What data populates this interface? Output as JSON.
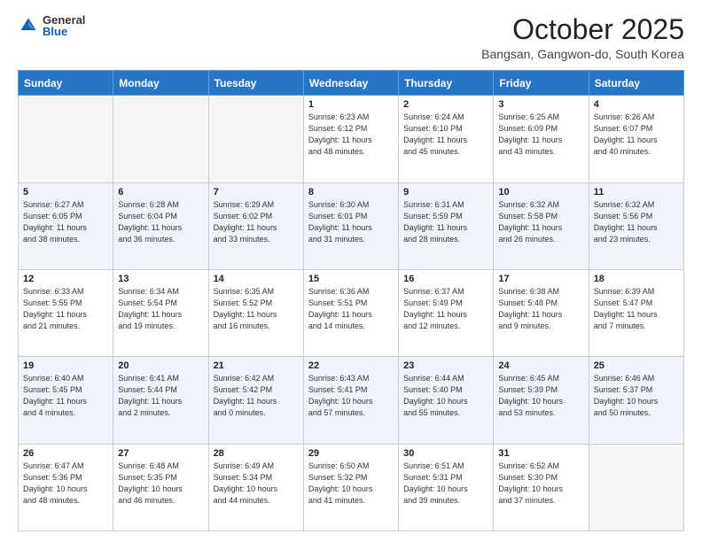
{
  "header": {
    "logo_general": "General",
    "logo_blue": "Blue",
    "month_title": "October 2025",
    "location": "Bangsan, Gangwon-do, South Korea"
  },
  "days_of_week": [
    "Sunday",
    "Monday",
    "Tuesday",
    "Wednesday",
    "Thursday",
    "Friday",
    "Saturday"
  ],
  "weeks": [
    [
      {
        "num": "",
        "info": ""
      },
      {
        "num": "",
        "info": ""
      },
      {
        "num": "",
        "info": ""
      },
      {
        "num": "1",
        "info": "Sunrise: 6:23 AM\nSunset: 6:12 PM\nDaylight: 11 hours\nand 48 minutes."
      },
      {
        "num": "2",
        "info": "Sunrise: 6:24 AM\nSunset: 6:10 PM\nDaylight: 11 hours\nand 45 minutes."
      },
      {
        "num": "3",
        "info": "Sunrise: 6:25 AM\nSunset: 6:09 PM\nDaylight: 11 hours\nand 43 minutes."
      },
      {
        "num": "4",
        "info": "Sunrise: 6:26 AM\nSunset: 6:07 PM\nDaylight: 11 hours\nand 40 minutes."
      }
    ],
    [
      {
        "num": "5",
        "info": "Sunrise: 6:27 AM\nSunset: 6:05 PM\nDaylight: 11 hours\nand 38 minutes."
      },
      {
        "num": "6",
        "info": "Sunrise: 6:28 AM\nSunset: 6:04 PM\nDaylight: 11 hours\nand 36 minutes."
      },
      {
        "num": "7",
        "info": "Sunrise: 6:29 AM\nSunset: 6:02 PM\nDaylight: 11 hours\nand 33 minutes."
      },
      {
        "num": "8",
        "info": "Sunrise: 6:30 AM\nSunset: 6:01 PM\nDaylight: 11 hours\nand 31 minutes."
      },
      {
        "num": "9",
        "info": "Sunrise: 6:31 AM\nSunset: 5:59 PM\nDaylight: 11 hours\nand 28 minutes."
      },
      {
        "num": "10",
        "info": "Sunrise: 6:32 AM\nSunset: 5:58 PM\nDaylight: 11 hours\nand 26 minutes."
      },
      {
        "num": "11",
        "info": "Sunrise: 6:32 AM\nSunset: 5:56 PM\nDaylight: 11 hours\nand 23 minutes."
      }
    ],
    [
      {
        "num": "12",
        "info": "Sunrise: 6:33 AM\nSunset: 5:55 PM\nDaylight: 11 hours\nand 21 minutes."
      },
      {
        "num": "13",
        "info": "Sunrise: 6:34 AM\nSunset: 5:54 PM\nDaylight: 11 hours\nand 19 minutes."
      },
      {
        "num": "14",
        "info": "Sunrise: 6:35 AM\nSunset: 5:52 PM\nDaylight: 11 hours\nand 16 minutes."
      },
      {
        "num": "15",
        "info": "Sunrise: 6:36 AM\nSunset: 5:51 PM\nDaylight: 11 hours\nand 14 minutes."
      },
      {
        "num": "16",
        "info": "Sunrise: 6:37 AM\nSunset: 5:49 PM\nDaylight: 11 hours\nand 12 minutes."
      },
      {
        "num": "17",
        "info": "Sunrise: 6:38 AM\nSunset: 5:48 PM\nDaylight: 11 hours\nand 9 minutes."
      },
      {
        "num": "18",
        "info": "Sunrise: 6:39 AM\nSunset: 5:47 PM\nDaylight: 11 hours\nand 7 minutes."
      }
    ],
    [
      {
        "num": "19",
        "info": "Sunrise: 6:40 AM\nSunset: 5:45 PM\nDaylight: 11 hours\nand 4 minutes."
      },
      {
        "num": "20",
        "info": "Sunrise: 6:41 AM\nSunset: 5:44 PM\nDaylight: 11 hours\nand 2 minutes."
      },
      {
        "num": "21",
        "info": "Sunrise: 6:42 AM\nSunset: 5:42 PM\nDaylight: 11 hours\nand 0 minutes."
      },
      {
        "num": "22",
        "info": "Sunrise: 6:43 AM\nSunset: 5:41 PM\nDaylight: 10 hours\nand 57 minutes."
      },
      {
        "num": "23",
        "info": "Sunrise: 6:44 AM\nSunset: 5:40 PM\nDaylight: 10 hours\nand 55 minutes."
      },
      {
        "num": "24",
        "info": "Sunrise: 6:45 AM\nSunset: 5:39 PM\nDaylight: 10 hours\nand 53 minutes."
      },
      {
        "num": "25",
        "info": "Sunrise: 6:46 AM\nSunset: 5:37 PM\nDaylight: 10 hours\nand 50 minutes."
      }
    ],
    [
      {
        "num": "26",
        "info": "Sunrise: 6:47 AM\nSunset: 5:36 PM\nDaylight: 10 hours\nand 48 minutes."
      },
      {
        "num": "27",
        "info": "Sunrise: 6:48 AM\nSunset: 5:35 PM\nDaylight: 10 hours\nand 46 minutes."
      },
      {
        "num": "28",
        "info": "Sunrise: 6:49 AM\nSunset: 5:34 PM\nDaylight: 10 hours\nand 44 minutes."
      },
      {
        "num": "29",
        "info": "Sunrise: 6:50 AM\nSunset: 5:32 PM\nDaylight: 10 hours\nand 41 minutes."
      },
      {
        "num": "30",
        "info": "Sunrise: 6:51 AM\nSunset: 5:31 PM\nDaylight: 10 hours\nand 39 minutes."
      },
      {
        "num": "31",
        "info": "Sunrise: 6:52 AM\nSunset: 5:30 PM\nDaylight: 10 hours\nand 37 minutes."
      },
      {
        "num": "",
        "info": ""
      }
    ]
  ]
}
